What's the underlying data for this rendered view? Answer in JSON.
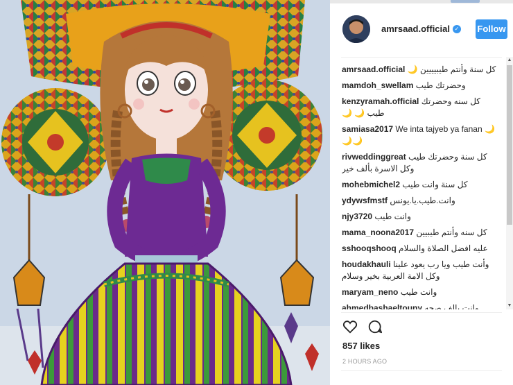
{
  "post": {
    "image_alt": "drawing"
  },
  "header": {
    "username": "amrsaad.official",
    "follow_label": "Follow",
    "verified_glyph": "✓"
  },
  "comments": [
    {
      "user": "amrsaad.official",
      "text": "كل سنة وأنتم طيبيييين 🌙"
    },
    {
      "user": "mamdoh_swellam",
      "text": "وحضرتك طيب"
    },
    {
      "user": "kenzyramah.official",
      "text": "كل سنه وحضرتك طيب 🌙 🌙"
    },
    {
      "user": "samiasa2017",
      "text": "We inta tajyeb ya fanan 🌙🌙🌙"
    },
    {
      "user": "rivweddinggreat",
      "text": "كل سنة وحضرتك طيب وكل الاسرة بألف خير"
    },
    {
      "user": "mohebmichel2",
      "text": "كل سنة وانت طيب"
    },
    {
      "user": "ydywsfmstf",
      "text": "وانت.طيب.يا.يونس"
    },
    {
      "user": "njy3720",
      "text": "وانت طيب"
    },
    {
      "user": "mama_noona2017",
      "text": "كل سنه وأنتم طيبيين"
    },
    {
      "user": "sshooqshooq",
      "text": "عليه افضل الصلاة والسلام"
    },
    {
      "user": "houdakhauli",
      "text": "وأنت طيب ويا رب يعود علينا وكل الامة العربية بخير وسلام"
    },
    {
      "user": "maryam_neno",
      "text": "وانت طيب"
    },
    {
      "user": "ahmedbashaeltouny",
      "text": "وانت بالف صحه وسلامه يا عمور"
    }
  ],
  "scrollbar": {
    "up": "▲",
    "down": "▼"
  },
  "footer": {
    "likes": "857 likes",
    "timestamp": "2 HOURS AGO"
  },
  "icons": {
    "like": "heart-icon",
    "comment": "comment-icon"
  },
  "colors": {
    "accent": "#3897f0",
    "text": "#262626",
    "muted": "#999999"
  }
}
